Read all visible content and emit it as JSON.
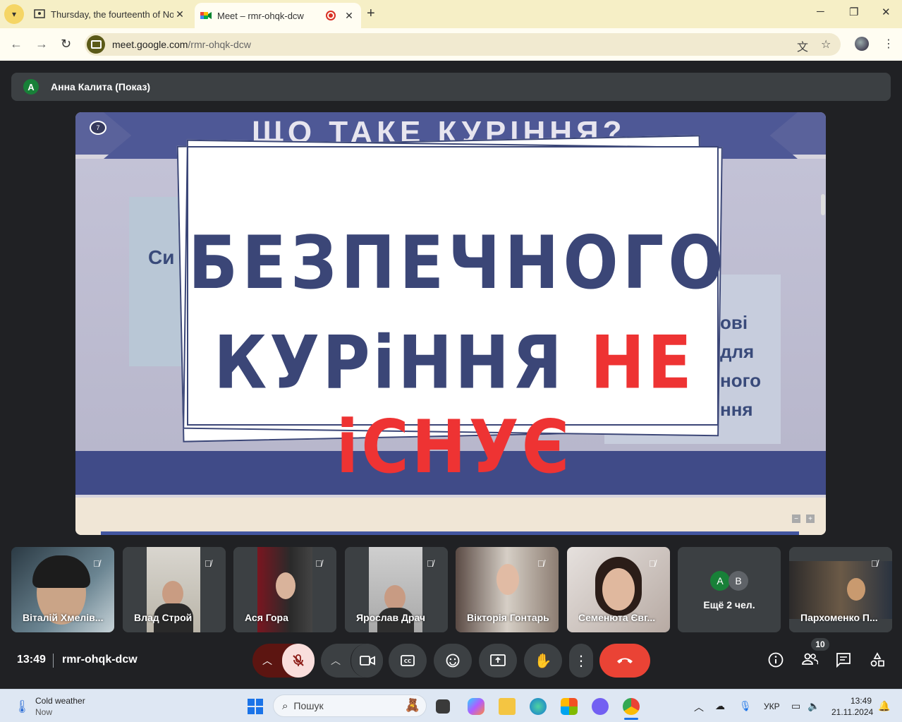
{
  "browser": {
    "tabs": [
      {
        "title": "Thursday, the fourteenth of No",
        "active": false
      },
      {
        "title": "Meet – rmr-ohqk-dcw",
        "active": true
      }
    ],
    "address": {
      "host": "meet.google.com",
      "path": "/rmr-ohqk-dcw"
    }
  },
  "meet": {
    "presenter": {
      "initial": "A",
      "name": "Анна Калита (Показ)"
    },
    "slide": {
      "counter": "7",
      "bg_heading": "ЩО ТАКЕ КУРІННЯ?",
      "bg_left_text": "Си",
      "bg_right_lines": [
        "ові",
        "для",
        "ного",
        "ння"
      ],
      "line1": "БЕЗПЕЧНОГО",
      "line2_dark": "КУРіННЯ ",
      "line2_red": "НЕ іСНУЄ"
    },
    "participants": [
      {
        "name": "Віталій Хмелів..."
      },
      {
        "name": "Влад Строй"
      },
      {
        "name": "Ася Гора"
      },
      {
        "name": "Ярослав Драч"
      },
      {
        "name": "Вікторія Гонтарь"
      },
      {
        "name": "Семенюта Євг..."
      },
      {
        "name": "Пархоменко П..."
      }
    ],
    "more": {
      "initials": [
        "A",
        "B"
      ],
      "label": "Ещё 2 чел."
    },
    "controls": {
      "time": "13:49",
      "meeting_code": "rmr-ohqk-dcw",
      "people_count": "10"
    }
  },
  "taskbar": {
    "weather_title": "Cold weather",
    "weather_sub": "Now",
    "search_placeholder": "Пошук",
    "lang": "УКР",
    "time": "13:49",
    "date": "21.11.2024"
  }
}
